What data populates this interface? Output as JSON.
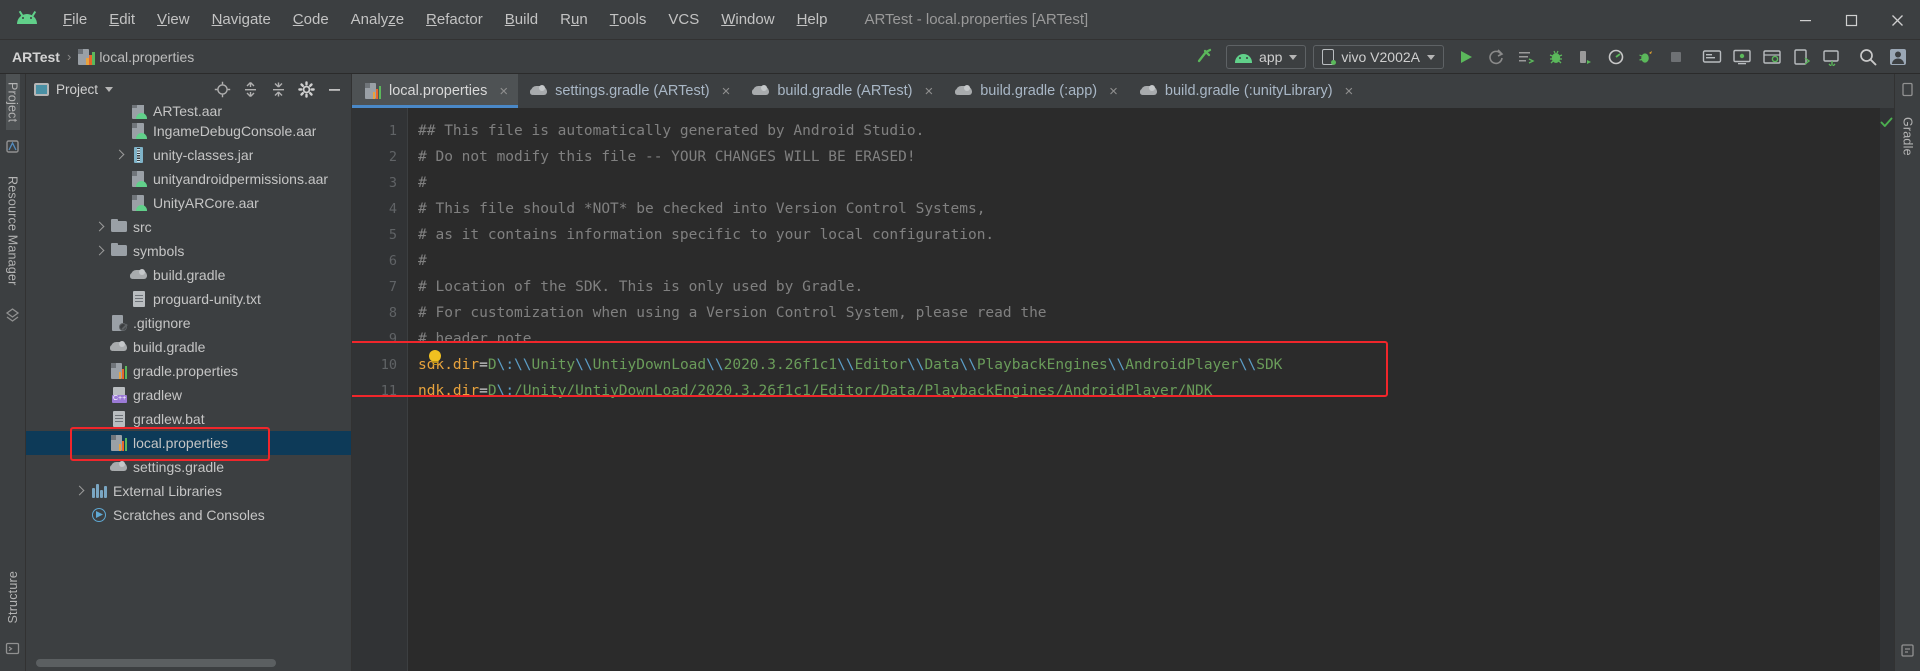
{
  "titlebar": {
    "logo_icon": "android-logo",
    "menus": [
      {
        "label": "File",
        "accel": "F"
      },
      {
        "label": "Edit",
        "accel": "E"
      },
      {
        "label": "View",
        "accel": "V"
      },
      {
        "label": "Navigate",
        "accel": "N"
      },
      {
        "label": "Code",
        "accel": "C"
      },
      {
        "label": "Analyze",
        "accel": "z"
      },
      {
        "label": "Refactor",
        "accel": "R"
      },
      {
        "label": "Build",
        "accel": "B"
      },
      {
        "label": "Run",
        "accel": "u"
      },
      {
        "label": "Tools",
        "accel": "T"
      },
      {
        "label": "VCS",
        "accel": ""
      },
      {
        "label": "Window",
        "accel": "W"
      },
      {
        "label": "Help",
        "accel": "H"
      }
    ],
    "window_title": "ARTest - local.properties [ARTest]",
    "controls": {
      "minimize": "minimize-icon",
      "maximize": "maximize-icon",
      "close": "close-icon"
    }
  },
  "toolbar": {
    "breadcrumb": {
      "root": "ARTest",
      "separator": "›",
      "file": "local.properties",
      "file_icon": "properties-file-icon"
    },
    "hammer_icon": "build-hammer-icon",
    "module_selector": {
      "label": "app",
      "icon": "android-module-icon"
    },
    "device_selector": {
      "label": "vivo V2002A",
      "icon": "device-phone-icon"
    },
    "actions": [
      {
        "name": "run-button",
        "icon": "play-triangle-icon"
      },
      {
        "name": "apply-changes-button",
        "icon": "apply-changes-icon"
      },
      {
        "name": "apply-code-changes-button",
        "icon": "apply-code-changes-icon"
      },
      {
        "name": "debug-button",
        "icon": "debug-bug-icon"
      },
      {
        "name": "attach-debugger-button",
        "icon": "attach-debugger-icon"
      },
      {
        "name": "profiler-button",
        "icon": "profiler-icon"
      },
      {
        "name": "run-coverage-button",
        "icon": "coverage-icon"
      },
      {
        "name": "stop-button",
        "icon": "stop-square-icon"
      },
      {
        "name": "sdk-manager-button",
        "icon": "sdk-manager-icon"
      },
      {
        "name": "avd-manager-button",
        "icon": "avd-manager-icon"
      },
      {
        "name": "layout-inspector-button",
        "icon": "layout-inspector-icon"
      },
      {
        "name": "device-file-explorer-button",
        "icon": "device-explorer-icon"
      },
      {
        "name": "sync-project-button",
        "icon": "gradle-sync-icon"
      },
      {
        "name": "search-everywhere-button",
        "icon": "search-icon"
      },
      {
        "name": "account-button",
        "icon": "user-avatar-icon"
      }
    ]
  },
  "left_strip": {
    "tabs": [
      {
        "label": "Project",
        "active": true
      },
      {
        "label": "Resource Manager",
        "active": false
      }
    ],
    "bottom_tabs": [
      {
        "label": "Structure",
        "active": false
      }
    ],
    "icons": [
      "favorites-icon",
      "build-variants-icon"
    ]
  },
  "right_strip": {
    "tabs": [
      {
        "label": "Gradle",
        "active": false
      }
    ],
    "icons": [
      "device-file-explorer-icon",
      "emulator-icon"
    ]
  },
  "project_panel": {
    "title": "Project",
    "title_icon": "project-view-icon",
    "dropdown_icon": "chevron-down-icon",
    "header_actions": [
      {
        "name": "select-opened-file-button",
        "icon": "crosshair-target-icon"
      },
      {
        "name": "expand-all-button",
        "icon": "expand-all-icon"
      },
      {
        "name": "collapse-all-button",
        "icon": "collapse-all-icon"
      },
      {
        "name": "settings-button",
        "icon": "gear-icon"
      },
      {
        "name": "hide-button",
        "icon": "minimize-line-icon"
      }
    ],
    "tree": [
      {
        "label": "ARTest.aar",
        "icon": "aar",
        "indent": 4,
        "arrow": false,
        "selected": false,
        "clipped": true
      },
      {
        "label": "IngameDebugConsole.aar",
        "icon": "aar",
        "indent": 4,
        "arrow": false,
        "selected": false
      },
      {
        "label": "unity-classes.jar",
        "icon": "jar",
        "indent": 4,
        "arrow": true,
        "selected": false
      },
      {
        "label": "unityandroidpermissions.aar",
        "icon": "aar",
        "indent": 4,
        "arrow": false,
        "selected": false
      },
      {
        "label": "UnityARCore.aar",
        "icon": "aar",
        "indent": 4,
        "arrow": false,
        "selected": false
      },
      {
        "label": "src",
        "icon": "folder",
        "indent": 3,
        "arrow": true,
        "selected": false
      },
      {
        "label": "symbols",
        "icon": "folder",
        "indent": 3,
        "arrow": true,
        "selected": false
      },
      {
        "label": "build.gradle",
        "icon": "gradle",
        "indent": 4,
        "arrow": false,
        "selected": false
      },
      {
        "label": "proguard-unity.txt",
        "icon": "txt",
        "indent": 4,
        "arrow": false,
        "selected": false
      },
      {
        "label": ".gitignore",
        "icon": "git",
        "indent": 3,
        "arrow": false,
        "selected": false
      },
      {
        "label": "build.gradle",
        "icon": "gradle",
        "indent": 3,
        "arrow": false,
        "selected": false
      },
      {
        "label": "gradle.properties",
        "icon": "props",
        "indent": 3,
        "arrow": false,
        "selected": false
      },
      {
        "label": "gradlew",
        "icon": "cpp",
        "indent": 3,
        "arrow": false,
        "selected": false,
        "badge": "C++"
      },
      {
        "label": "gradlew.bat",
        "icon": "txt",
        "indent": 3,
        "arrow": false,
        "selected": false
      },
      {
        "label": "local.properties",
        "icon": "props",
        "indent": 3,
        "arrow": false,
        "selected": true
      },
      {
        "label": "settings.gradle",
        "icon": "gradle",
        "indent": 3,
        "arrow": false,
        "selected": false
      },
      {
        "label": "External Libraries",
        "icon": "lib",
        "indent": 2,
        "arrow": true,
        "selected": false
      },
      {
        "label": "Scratches and Consoles",
        "icon": "scratch",
        "indent": 2,
        "arrow": false,
        "selected": false
      }
    ],
    "annotation_color": "#f0262b"
  },
  "editor_tabs": [
    {
      "label": "local.properties",
      "icon": "properties-file-icon",
      "active": true,
      "close": "×"
    },
    {
      "label": "settings.gradle (ARTest)",
      "icon": "gradle-file-icon",
      "active": false,
      "close": "×"
    },
    {
      "label": "build.gradle (ARTest)",
      "icon": "gradle-file-icon",
      "active": false,
      "close": "×"
    },
    {
      "label": "build.gradle (:app)",
      "icon": "gradle-file-icon",
      "active": false,
      "close": "×"
    },
    {
      "label": "build.gradle (:unityLibrary)",
      "icon": "gradle-file-icon",
      "active": false,
      "close": "×"
    }
  ],
  "editor": {
    "line_numbers": [
      "1",
      "2",
      "3",
      "4",
      "5",
      "6",
      "7",
      "8",
      "9",
      "10",
      "11"
    ],
    "lines": [
      {
        "n": 1,
        "type": "comment",
        "text": "## This file is automatically generated by Android Studio."
      },
      {
        "n": 2,
        "type": "comment",
        "text": "# Do not modify this file -- YOUR CHANGES WILL BE ERASED!"
      },
      {
        "n": 3,
        "type": "comment",
        "text": "#"
      },
      {
        "n": 4,
        "type": "comment",
        "text": "# This file should *NOT* be checked into Version Control Systems,"
      },
      {
        "n": 5,
        "type": "comment",
        "text": "# as it contains information specific to your local configuration."
      },
      {
        "n": 6,
        "type": "comment",
        "text": "#"
      },
      {
        "n": 7,
        "type": "comment",
        "text": "# Location of the SDK. This is only used by Gradle."
      },
      {
        "n": 8,
        "type": "comment",
        "text": "# For customization when using a Version Control System, please read the"
      },
      {
        "n": 9,
        "type": "comment",
        "text": "# header note."
      },
      {
        "n": 10,
        "type": "property",
        "key": "sdk.dir",
        "eq": "=",
        "value": "D\\:\\\\Unity\\\\UntiyDownLoad\\\\2020.3.26f1c1\\\\Editor\\\\Data\\\\PlaybackEngines\\\\AndroidPlayer\\\\SDK"
      },
      {
        "n": 11,
        "type": "property",
        "key": "ndk.dir",
        "eq": "=",
        "value": "D\\:/Unity/UntiyDownLoad/2020.3.26f1c1/Editor/Data/PlaybackEngines/AndroidPlayer/NDK"
      }
    ],
    "inspection_status": "ok-checkmark-icon",
    "bulb_icon": "intention-bulb-icon",
    "annotation_color": "#f0262b"
  },
  "colors": {
    "chrome_bg": "#3c3f41",
    "editor_bg": "#2b2b2b",
    "gutter_bg": "#313335",
    "selection_blue": "#0d3a58",
    "tab_active": "#4e5254",
    "accent_blue": "#4a88c7",
    "comment": "#808080",
    "key_orange": "#e8a33d",
    "value_green": "#6a9c5a",
    "escape_blue": "#5c9ec7",
    "annotation_red": "#f0262b",
    "droid_green": "#61d08a"
  }
}
